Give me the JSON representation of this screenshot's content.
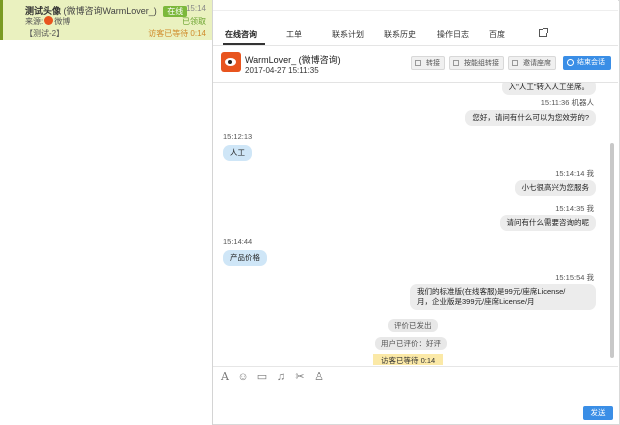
{
  "session": {
    "name": "测试头像",
    "channel_name": "(微博咨询WarmLover_)",
    "status_badge": "在线",
    "time": "15:14",
    "source_label": "来源:",
    "source_channel": "微博",
    "received_label": "已领取",
    "tag": "【测试-2】",
    "waiting": "访客已等待 0:14"
  },
  "tabs": [
    "在线咨询",
    "工单",
    "联系计划",
    "联系历史",
    "操作日志",
    "百度"
  ],
  "visitor": {
    "name": "WarmLover_ (微博咨询)",
    "time": "2017-04-27 15:11:35"
  },
  "actions": {
    "transfer": "转接",
    "group_transfer": "按能组转接",
    "invite": "邀请座席",
    "end": "结束会话"
  },
  "messages": {
    "m0_text": "入\"人工\"转入人工坐席。",
    "m1_time": "15:11:36 机器人",
    "m1_text": "您好，请问有什么可以为您效劳的?",
    "m2_time": "15:12:13",
    "m2_text": "人工",
    "m3_time": "15:14:14 我",
    "m3_text": "小七很高兴为您服务",
    "m4_time": "15:14:35 我",
    "m4_text": "请问有什么需要咨询的呢",
    "m5_time": "15:14:44",
    "m5_text": "产品价格",
    "m6_time": "15:15:54 我",
    "m6_line1": "我们的标准版(在线客服)是99元/座席License/",
    "m6_line2": "月，企业版是399元/座席License/月",
    "sys1": "评价已发出",
    "sys2": "用户已评价：好评",
    "wait": "访客已等待 0:14"
  },
  "toolbar": {
    "icons": [
      "text-format-icon",
      "emoji-icon",
      "image-icon",
      "bell-icon",
      "scissors-icon",
      "user-search-icon"
    ]
  },
  "send_label": "发送",
  "colors": {
    "session_bg": "#eaf1bf",
    "online_badge": "#7cb83c",
    "primary_button": "#3a8ee6",
    "visitor_bubble": "#cfe6f7",
    "agent_bubble": "#ececec",
    "weibo_orange": "#e8541e",
    "wait_bg": "#fbe9a7"
  }
}
